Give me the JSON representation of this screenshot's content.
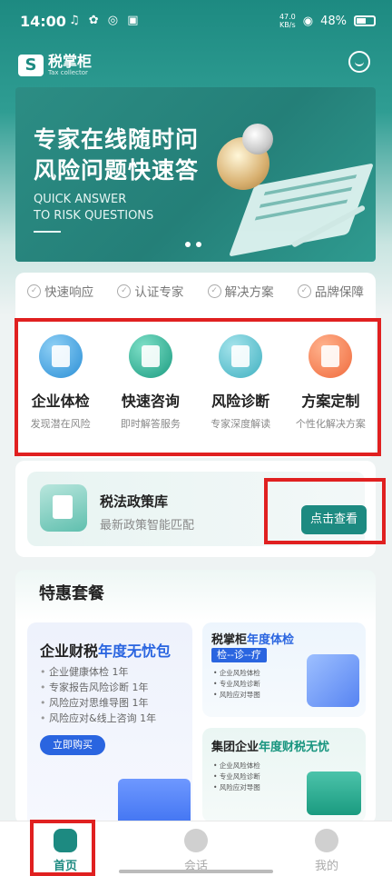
{
  "status": {
    "time": "14:00",
    "left_icons": "♫ ✿ ◎ ▣",
    "speed": "47.0",
    "speed_unit": "KB/s",
    "battery": "48%"
  },
  "brand": {
    "name": "税掌柜",
    "subtitle": "Tax collector",
    "logo_letter": "S"
  },
  "banner": {
    "line1": "专家在线随时问",
    "line2": "风险问题快速答",
    "en1": "QUICK ANSWER",
    "en2": "TO RISK QUESTIONS"
  },
  "tags": [
    "快速响应",
    "认证专家",
    "解决方案",
    "品牌保障"
  ],
  "features": [
    {
      "title": "企业体检",
      "sub": "发现潜在风险"
    },
    {
      "title": "快速咨询",
      "sub": "即时解答服务"
    },
    {
      "title": "风险诊断",
      "sub": "专家深度解读"
    },
    {
      "title": "方案定制",
      "sub": "个性化解决方案"
    }
  ],
  "policy": {
    "title": "税法政策库",
    "sub": "最新政策智能匹配",
    "button": "点击查看"
  },
  "packages": {
    "title": "特惠套餐",
    "card1": {
      "title_a": "企业财税",
      "title_b": "年度无忧包",
      "items": [
        "企业健康体检 1年",
        "专家报告风险诊断 1年",
        "风险应对思维导图 1年",
        "风险应对&线上咨询  1年"
      ],
      "button": "立即购买"
    },
    "card2": {
      "title_a": "税掌柜",
      "title_b": "年度体检",
      "tag": "检--诊--疗",
      "items": [
        "企业风险体检",
        "专业风险诊断",
        "风险应对导图"
      ]
    },
    "card3": {
      "title_a": "集团企业",
      "title_b": "年度财税无忧",
      "items": [
        "企业风险体检",
        "专业风险诊断",
        "风险应对导图"
      ]
    }
  },
  "tabbar": [
    {
      "label": "首页",
      "icon": "home-icon",
      "active": true
    },
    {
      "label": "会话",
      "icon": "chat-icon",
      "active": false
    },
    {
      "label": "我的",
      "icon": "user-icon",
      "active": false
    }
  ],
  "colors": {
    "brand": "#1d8a81",
    "accent_blue": "#2a65e0",
    "highlight_red": "#e02020"
  }
}
